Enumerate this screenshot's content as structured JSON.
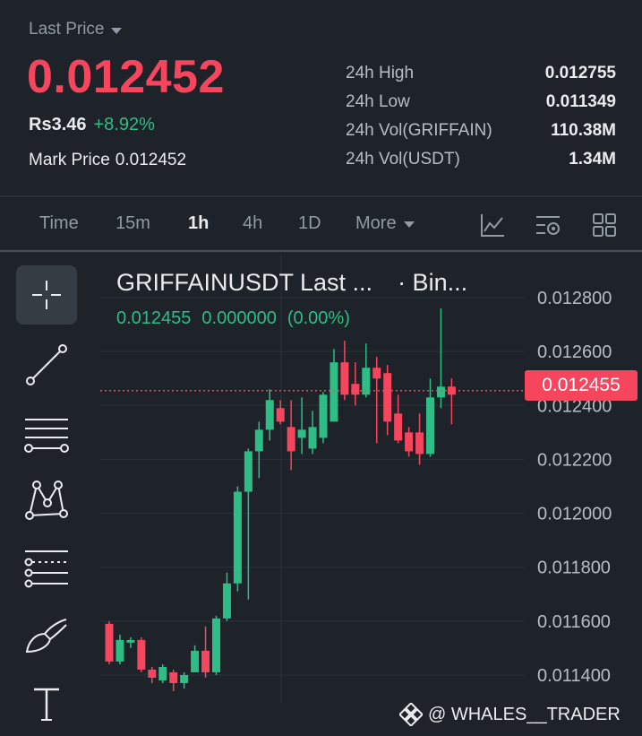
{
  "header": {
    "price_type_label": "Last Price",
    "last_price": "0.012452",
    "fiat_price": "Rs3.46",
    "change_pct": "+8.92%",
    "mark_price_label": "Mark Price",
    "mark_price": "0.012452",
    "stats": [
      {
        "label": "24h High",
        "value": "0.012755"
      },
      {
        "label": "24h Low",
        "value": "0.011349"
      },
      {
        "label": "24h Vol(GRIFFAIN)",
        "value": "110.38M"
      },
      {
        "label": "24h Vol(USDT)",
        "value": "1.34M"
      }
    ]
  },
  "timeframes": {
    "items": [
      "Time",
      "15m",
      "1h",
      "4h",
      "1D"
    ],
    "active": "1h",
    "more_label": "More"
  },
  "toolbar_icons": [
    "indicator-icon",
    "chart-settings-icon",
    "layout-grid-icon"
  ],
  "drawing_tools": [
    "crosshair-icon",
    "trendline-icon",
    "horizontal-lines-icon",
    "pattern-icon",
    "fib-icon",
    "brush-icon",
    "text-icon"
  ],
  "chart": {
    "symbol_title": "GRIFFAINUSDT Last ...",
    "source_label": "· Bin...",
    "ohlc_price": "0.012455",
    "ohlc_change": "0.000000",
    "ohlc_change_pct": "(0.00%)",
    "current_price_tag": "0.012455"
  },
  "watermark": "@ WHALES__TRADER",
  "colors": {
    "up": "#2ebd85",
    "down": "#f6465d",
    "bg": "#1e2329"
  },
  "chart_data": {
    "type": "candlestick",
    "y_ticks": [
      "0.012800",
      "0.012600",
      "0.012400",
      "0.012200",
      "0.012000",
      "0.011800",
      "0.011600",
      "0.011400"
    ],
    "ylim": [
      0.01137,
      0.01284
    ],
    "current_price": 0.012455,
    "candles": [
      {
        "o": 0.01159,
        "h": 0.0116,
        "c": 0.01145,
        "l": 0.01144
      },
      {
        "o": 0.01145,
        "h": 0.01155,
        "c": 0.01153,
        "l": 0.01144
      },
      {
        "o": 0.01152,
        "h": 0.01154,
        "c": 0.01153,
        "l": 0.0115
      },
      {
        "o": 0.01153,
        "h": 0.01154,
        "c": 0.01142,
        "l": 0.01141
      },
      {
        "o": 0.01142,
        "h": 0.01143,
        "c": 0.01139,
        "l": 0.01137
      },
      {
        "o": 0.01138,
        "h": 0.01144,
        "c": 0.01143,
        "l": 0.01137
      },
      {
        "o": 0.01141,
        "h": 0.01142,
        "c": 0.01137,
        "l": 0.01134
      },
      {
        "o": 0.01137,
        "h": 0.01141,
        "c": 0.0114,
        "l": 0.01135
      },
      {
        "o": 0.01141,
        "h": 0.01151,
        "c": 0.01149,
        "l": 0.01141
      },
      {
        "o": 0.01149,
        "h": 0.01158,
        "c": 0.01141,
        "l": 0.01139
      },
      {
        "o": 0.01141,
        "h": 0.01162,
        "c": 0.01161,
        "l": 0.0114
      },
      {
        "o": 0.01161,
        "h": 0.01178,
        "c": 0.01174,
        "l": 0.0116
      },
      {
        "o": 0.01174,
        "h": 0.0121,
        "c": 0.01208,
        "l": 0.01171
      },
      {
        "o": 0.01208,
        "h": 0.01224,
        "c": 0.01223,
        "l": 0.01168
      },
      {
        "o": 0.01223,
        "h": 0.01234,
        "c": 0.01231,
        "l": 0.01213
      },
      {
        "o": 0.01231,
        "h": 0.01246,
        "c": 0.01242,
        "l": 0.01227
      },
      {
        "o": 0.01239,
        "h": 0.01242,
        "c": 0.01234,
        "l": 0.01233
      },
      {
        "o": 0.01232,
        "h": 0.01242,
        "c": 0.01223,
        "l": 0.01216
      },
      {
        "o": 0.01228,
        "h": 0.01243,
        "c": 0.01231,
        "l": 0.01222
      },
      {
        "o": 0.01224,
        "h": 0.01238,
        "c": 0.01232,
        "l": 0.01222
      },
      {
        "o": 0.01228,
        "h": 0.01245,
        "c": 0.01244,
        "l": 0.01226
      },
      {
        "o": 0.01234,
        "h": 0.01261,
        "c": 0.01256,
        "l": 0.01234
      },
      {
        "o": 0.01256,
        "h": 0.01264,
        "c": 0.01244,
        "l": 0.01242
      },
      {
        "o": 0.01248,
        "h": 0.01256,
        "c": 0.01244,
        "l": 0.0124
      },
      {
        "o": 0.01244,
        "h": 0.01263,
        "c": 0.01254,
        "l": 0.01243
      },
      {
        "o": 0.01254,
        "h": 0.01258,
        "c": 0.0125,
        "l": 0.01226
      },
      {
        "o": 0.01252,
        "h": 0.01255,
        "c": 0.01234,
        "l": 0.01229
      },
      {
        "o": 0.01237,
        "h": 0.01244,
        "c": 0.01227,
        "l": 0.01226
      },
      {
        "o": 0.0123,
        "h": 0.01232,
        "c": 0.01223,
        "l": 0.01221
      },
      {
        "o": 0.0123,
        "h": 0.01237,
        "c": 0.01222,
        "l": 0.01218
      },
      {
        "o": 0.01222,
        "h": 0.0125,
        "c": 0.01243,
        "l": 0.01221
      },
      {
        "o": 0.01243,
        "h": 0.01276,
        "c": 0.01247,
        "l": 0.01239
      },
      {
        "o": 0.01247,
        "h": 0.0125,
        "c": 0.01244,
        "l": 0.01233
      }
    ]
  }
}
